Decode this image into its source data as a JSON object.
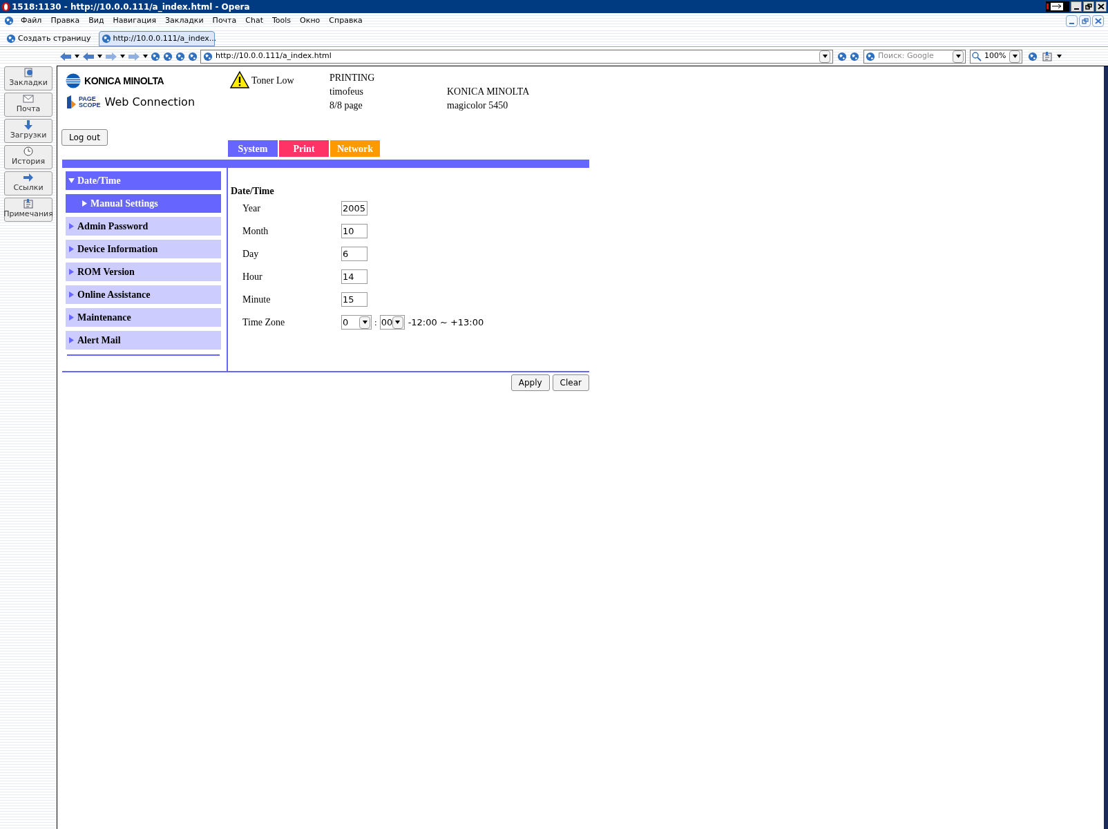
{
  "window": {
    "title": "1518:1130 - http://10.0.0.111/a_index.html - Opera"
  },
  "menu": [
    "Файл",
    "Правка",
    "Вид",
    "Навигация",
    "Закладки",
    "Почта",
    "Chat",
    "Tools",
    "Окно",
    "Справка"
  ],
  "tabs": [
    {
      "label": "Создать страницу",
      "selected": false
    },
    {
      "label": "http://10.0.0.111/a_index...",
      "selected": true
    }
  ],
  "address": "http://10.0.0.111/a_index.html",
  "search": {
    "placeholder": "Поиск: Google"
  },
  "zoom": "100%",
  "panel": [
    "Закладки",
    "Почта",
    "Загрузки",
    "История",
    "Ссылки",
    "Примечания"
  ],
  "page": {
    "logo": {
      "brand": "KONICA MINOLTA",
      "badge_top": "PAGE",
      "badge_bottom": "SCOPE",
      "product": "Web Connection"
    },
    "toner": "Toner Low",
    "status": [
      "PRINTING",
      "timofeus",
      "8/8 page"
    ],
    "device": [
      "KONICA MINOLTA",
      "magicolor 5450"
    ],
    "logout": "Log out",
    "categories": [
      {
        "label": "System",
        "color": "#6666ff"
      },
      {
        "label": "Print",
        "color": "#ff3366"
      },
      {
        "label": "Network",
        "color": "#ff9900"
      }
    ],
    "sidebar": [
      {
        "label": "Date/Time",
        "expanded": true,
        "children": [
          {
            "label": "Manual Settings",
            "selected": true
          }
        ]
      },
      {
        "label": "Admin Password",
        "expanded": false
      },
      {
        "label": "Device Information",
        "expanded": false
      },
      {
        "label": "ROM Version",
        "expanded": false
      },
      {
        "label": "Online Assistance",
        "expanded": false
      },
      {
        "label": "Maintenance",
        "expanded": false
      },
      {
        "label": "Alert Mail",
        "expanded": false
      }
    ],
    "form": {
      "title": "Date/Time",
      "fields": [
        {
          "label": "Year",
          "value": "2005"
        },
        {
          "label": "Month",
          "value": "10"
        },
        {
          "label": "Day",
          "value": "6"
        },
        {
          "label": "Hour",
          "value": "14"
        },
        {
          "label": "Minute",
          "value": "15"
        }
      ],
      "timezone": {
        "label": "Time Zone",
        "hours": "0",
        "separator": ":",
        "minutes": "00",
        "range": "-12:00 ~ +13:00"
      }
    },
    "buttons": [
      "Apply",
      "Clear"
    ]
  }
}
